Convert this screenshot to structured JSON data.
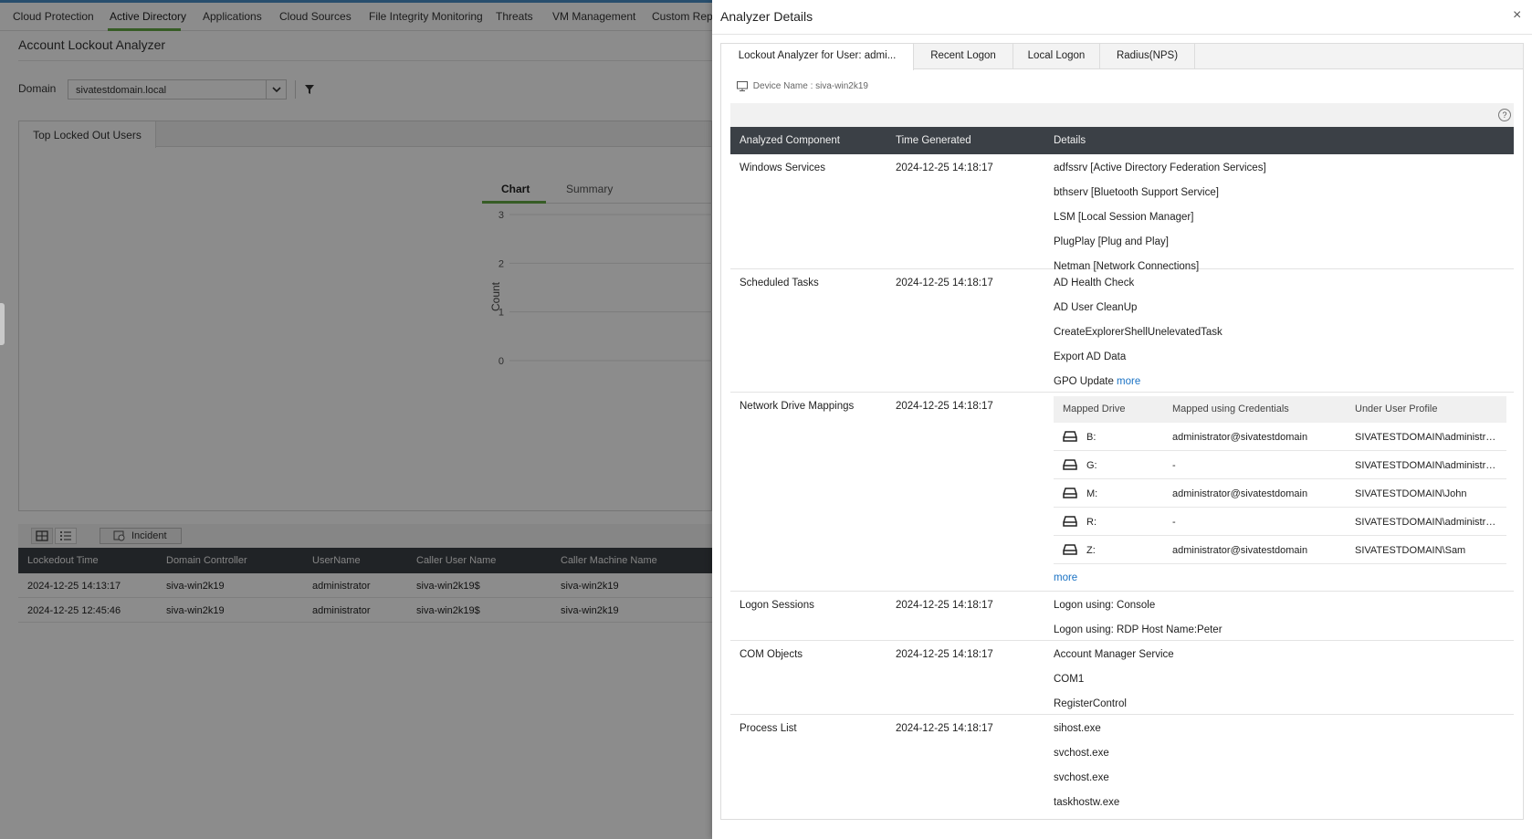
{
  "nav": {
    "items": [
      "Cloud Protection",
      "Active Directory",
      "Applications",
      "Cloud Sources",
      "File Integrity Monitoring",
      "Threats",
      "VM Management",
      "Custom Repo"
    ]
  },
  "page": {
    "title": "Account Lockout Analyzer",
    "domain_label": "Domain",
    "domain_value": "sivatestdomain.local"
  },
  "panel": {
    "tab": "Top Locked Out Users",
    "chart_tab": "Chart",
    "summary_tab": "Summary"
  },
  "chart_data": {
    "type": "bar",
    "title": "",
    "xlabel": "",
    "ylabel": "Count",
    "ylim": [
      0,
      3
    ],
    "yticks": [
      "3",
      "2",
      "1",
      "0"
    ],
    "categories": [],
    "values": []
  },
  "grid": {
    "incident_label": "Incident",
    "columns": [
      "Lockedout Time",
      "Domain Controller",
      "UserName",
      "Caller User Name",
      "Caller Machine Name"
    ],
    "rows": [
      [
        "2024-12-25 14:13:17",
        "siva-win2k19",
        "administrator",
        "siva-win2k19$",
        "siva-win2k19"
      ],
      [
        "2024-12-25 12:45:46",
        "siva-win2k19",
        "administrator",
        "siva-win2k19$",
        "siva-win2k19"
      ]
    ]
  },
  "drawer": {
    "title": "Analyzer Details",
    "close": "×",
    "tabs": [
      "Lockout Analyzer for User:  admi...",
      "Recent Logon",
      "Local Logon",
      "Radius(NPS)"
    ],
    "device_name": "Device Name : siva-win2k19",
    "help": "?",
    "columns": [
      "Analyzed Component",
      "Time Generated",
      "Details"
    ],
    "more_label": "more",
    "sections": {
      "services": {
        "component": "Windows Services",
        "time": "2024-12-25 14:18:17",
        "details": [
          "adfssrv [Active Directory Federation Services]",
          "bthserv [Bluetooth Support Service]",
          "LSM [Local Session Manager]",
          "PlugPlay [Plug and Play]",
          "Netman [Network Connections]"
        ]
      },
      "tasks": {
        "component": "Scheduled Tasks",
        "time": "2024-12-25 14:18:17",
        "details": [
          "AD Health Check",
          "AD User CleanUp",
          "CreateExplorerShellUnelevatedTask",
          "Export AD Data",
          "GPO Update"
        ]
      },
      "drives": {
        "component": "Network Drive Mappings",
        "time": "2024-12-25 14:18:17",
        "columns": [
          "Mapped Drive",
          "Mapped using Credentials",
          "Under User Profile"
        ],
        "rows": [
          [
            "B:",
            "administrator@sivatestdomain",
            "SIVATESTDOMAIN\\administrator"
          ],
          [
            "G:",
            "-",
            "SIVATESTDOMAIN\\administrator"
          ],
          [
            "M:",
            "administrator@sivatestdomain",
            "SIVATESTDOMAIN\\John"
          ],
          [
            "R:",
            "-",
            "SIVATESTDOMAIN\\administrator"
          ],
          [
            "Z:",
            "administrator@sivatestdomain",
            "SIVATESTDOMAIN\\Sam"
          ]
        ]
      },
      "logon": {
        "component": "Logon Sessions",
        "time": "2024-12-25 14:18:17",
        "details": [
          "Logon using: Console",
          "Logon using: RDP Host Name:Peter"
        ]
      },
      "com": {
        "component": "COM Objects",
        "time": "2024-12-25 14:18:17",
        "details": [
          "Account Manager Service",
          "COM1",
          "RegisterControl"
        ]
      },
      "process": {
        "component": "Process List",
        "time": "2024-12-25 14:18:17",
        "details": [
          "sihost.exe",
          "svchost.exe",
          "svchost.exe",
          "taskhostw.exe"
        ]
      }
    }
  },
  "colors": {
    "accent_green": "#63a844",
    "header_dark": "#3b4046",
    "link_blue": "#1a72c4"
  }
}
